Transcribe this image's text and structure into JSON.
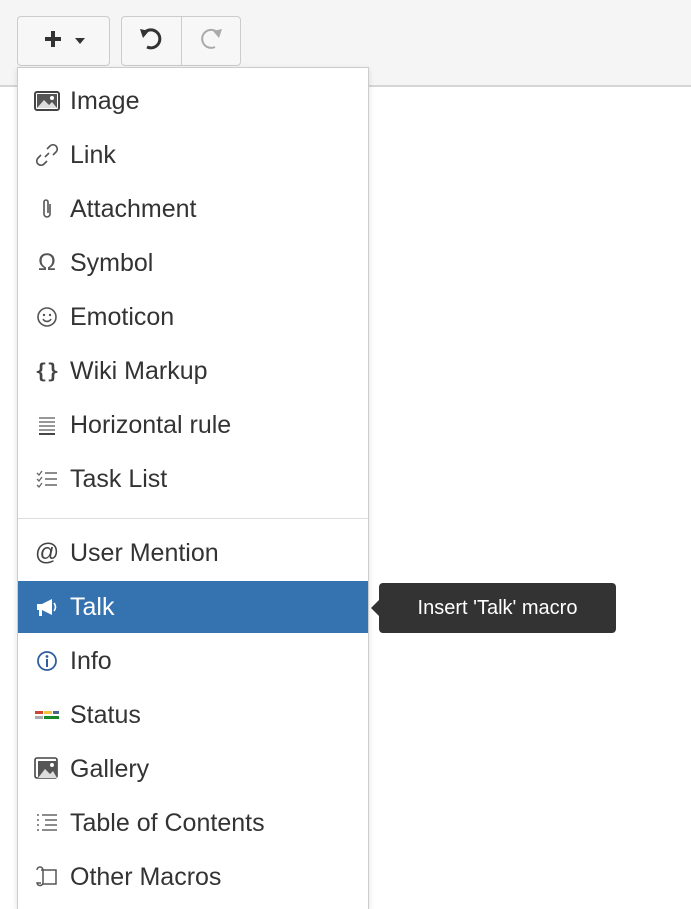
{
  "toolbar": {
    "insert_button_icon": "plus-icon",
    "insert_dropdown_icon": "caret-down-icon",
    "undo_icon": "undo-icon",
    "redo_icon": "redo-icon"
  },
  "menu": {
    "items": [
      {
        "label": "Image",
        "icon": "image-icon"
      },
      {
        "label": "Link",
        "icon": "link-icon"
      },
      {
        "label": "Attachment",
        "icon": "paperclip-icon"
      },
      {
        "label": "Symbol",
        "icon": "omega-icon"
      },
      {
        "label": "Emoticon",
        "icon": "smiley-icon"
      },
      {
        "label": "Wiki Markup",
        "icon": "braces-icon"
      },
      {
        "label": "Horizontal rule",
        "icon": "horizontal-rule-icon"
      },
      {
        "label": "Task List",
        "icon": "task-list-icon"
      },
      {
        "label": "User Mention",
        "icon": "at-icon"
      },
      {
        "label": "Talk",
        "icon": "megaphone-icon",
        "selected": true
      },
      {
        "label": "Info",
        "icon": "info-icon"
      },
      {
        "label": "Status",
        "icon": "status-icon"
      },
      {
        "label": "Gallery",
        "icon": "gallery-icon"
      },
      {
        "label": "Table of Contents",
        "icon": "toc-icon"
      },
      {
        "label": "Other Macros",
        "icon": "macro-icon"
      }
    ]
  },
  "tooltip": {
    "text": "Insert 'Talk' macro"
  },
  "colors": {
    "selected_bg": "#3572b0",
    "tooltip_bg": "#333333"
  }
}
